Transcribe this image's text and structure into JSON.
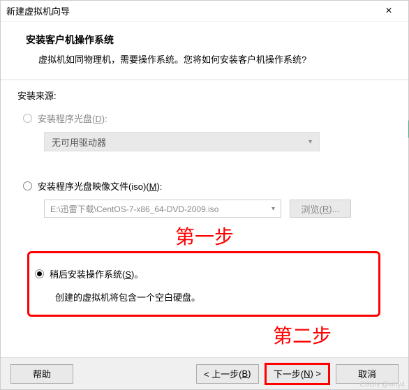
{
  "titlebar": {
    "title": "新建虚拟机向导",
    "close": "×"
  },
  "header": {
    "title": "安装客户机操作系统",
    "sub": "虚拟机如同物理机，需要操作系统。您将如何安装客户机操作系统?"
  },
  "source_label": "安装来源:",
  "opt_disc": {
    "pre": "安装程序光盘(",
    "key": "D",
    "post": "):"
  },
  "combo_disc": "无可用驱动器",
  "opt_iso": {
    "pre": "安装程序光盘映像文件(iso)(",
    "key": "M",
    "post": "):"
  },
  "iso_path": "E:\\迅雷下载\\CentOS-7-x86_64-DVD-2009.iso",
  "browse": {
    "pre": "浏览(",
    "key": "R",
    "post": ")..."
  },
  "step1": "第一步",
  "opt_later": {
    "pre": "稍后安装操作系统(",
    "key": "S",
    "post": ")。"
  },
  "later_sub": "创建的虚拟机将包含一个空白硬盘。",
  "step2": "第二步",
  "footer": {
    "help": "帮助",
    "back": {
      "pre": "< 上一步(",
      "key": "B",
      "post": ")"
    },
    "next": {
      "pre": "下一步(",
      "key": "N",
      "post": ") >"
    },
    "cancel": "取消"
  },
  "watermark": "CSDN @why4"
}
